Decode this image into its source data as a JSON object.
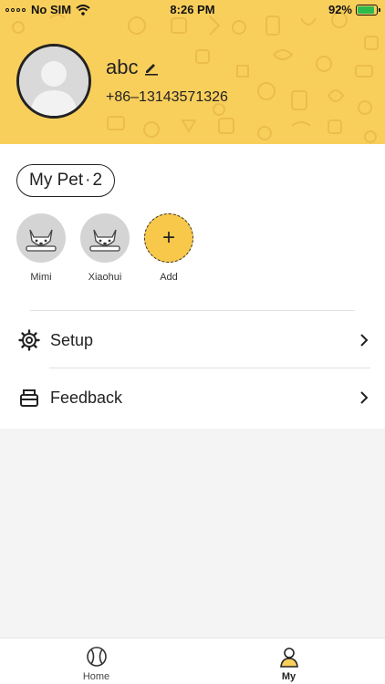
{
  "status_bar": {
    "carrier": "No SIM",
    "time": "8:26 PM",
    "battery": "92%"
  },
  "profile": {
    "username": "abc",
    "phone": "+86–13143571326"
  },
  "pets_section": {
    "label": "My Pet",
    "separator": "·",
    "count": "2",
    "pets": [
      {
        "name": "Mimi"
      },
      {
        "name": "Xiaohui"
      }
    ],
    "add_label": "Add"
  },
  "menu": {
    "setup": {
      "label": "Setup",
      "icon": "gear-icon"
    },
    "feedback": {
      "label": "Feedback",
      "icon": "inbox-icon"
    }
  },
  "tabbar": {
    "tabs": [
      {
        "label": "Home",
        "icon": "tennis-ball-icon",
        "active": false
      },
      {
        "label": "My",
        "icon": "person-icon",
        "active": true
      }
    ]
  },
  "colors": {
    "accent": "#f9cf5c",
    "add_button": "#f8c84a",
    "background": "#f4f4f5"
  }
}
